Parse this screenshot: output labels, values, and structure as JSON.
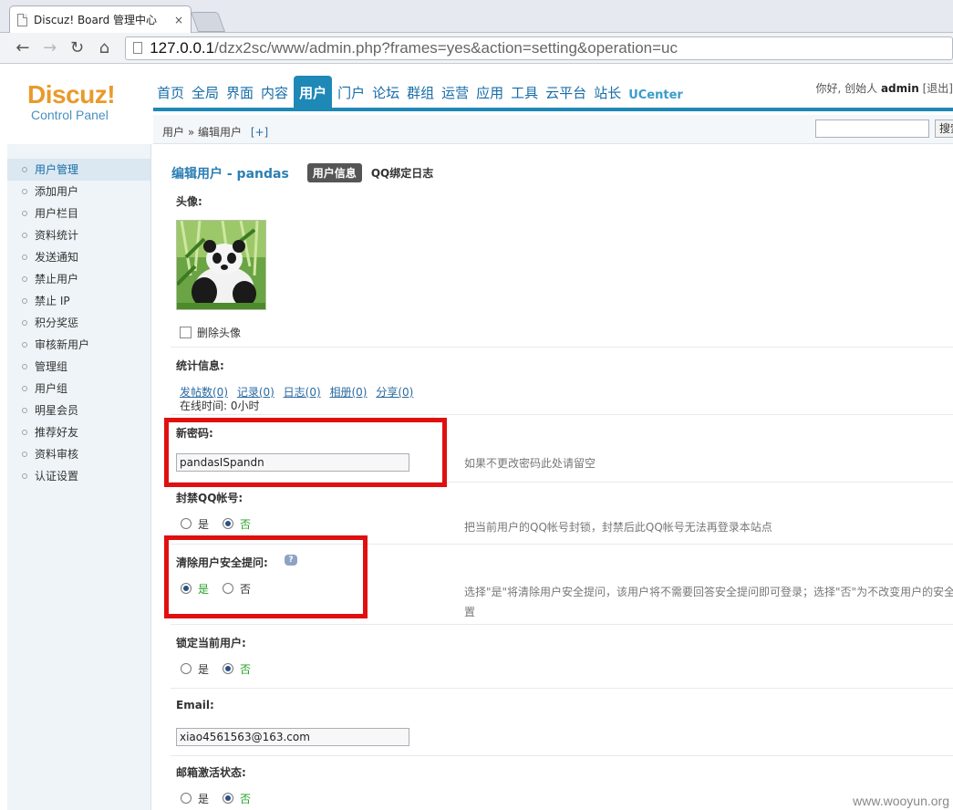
{
  "browser": {
    "tab_title": "Discuz! Board 管理中心",
    "tab_close": "×",
    "url_host": "127.0.0.1",
    "url_path": "/dzx2sc/www/admin.php?frames=yes&action=setting&operation=uc",
    "back": "←",
    "forward": "→",
    "reload": "↻",
    "home": "⌂"
  },
  "header": {
    "logo_main": "Discuz!",
    "logo_sub": "Control Panel",
    "nav": [
      "首页",
      "全局",
      "界面",
      "内容",
      "用户",
      "门户",
      "论坛",
      "群组",
      "运营",
      "应用",
      "工具",
      "云平台",
      "站长",
      "UCenter"
    ],
    "active_nav": "用户",
    "greeting": "你好, 创始人",
    "username": "admin",
    "logout": "[退出]",
    "breadcrumb": "用户 » 编辑用户",
    "breadcrumb_add": "[+]",
    "search_button": "搜索"
  },
  "sidebar": {
    "items": [
      "用户管理",
      "添加用户",
      "用户栏目",
      "资料统计",
      "发送通知",
      "禁止用户",
      "禁止 IP",
      "积分奖惩",
      "审核新用户",
      "管理组",
      "用户组",
      "明星会员",
      "推荐好友",
      "资料审核",
      "认证设置"
    ]
  },
  "main": {
    "title": "编辑用户 - pandas",
    "tab_active": "用户信息",
    "tab_other": "QQ绑定日志",
    "avatar_label": "头像:",
    "delete_avatar": "删除头像",
    "stats_label": "统计信息:",
    "stats": [
      "发帖数(0)",
      "记录(0)",
      "日志(0)",
      "相册(0)",
      "分享(0)"
    ],
    "online_time": "在线时间: 0小时",
    "new_password_label": "新密码:",
    "new_password_value": "pandasISpandn",
    "new_password_hint": "如果不更改密码此处请留空",
    "ban_qq_label": "封禁QQ帐号:",
    "ban_qq_hint": "把当前用户的QQ帐号封锁，封禁后此QQ帐号无法再登录本站点",
    "clear_security_label": "清除用户安全提问:",
    "clear_security_hint_line1": "选择\"是\"将清除用户安全提问，该用户将不需要回答安全提问即可登录；选择\"否\"为不改变用户的安全",
    "clear_security_hint_line2": "置",
    "lock_user_label": "锁定当前用户:",
    "email_label": "Email:",
    "email_value": "xiao4561563@163.com",
    "email_status_label": "邮箱激活状态:",
    "yes": "是",
    "no": "否",
    "help": "?"
  },
  "watermark": "www.wooyun.org",
  "colors": {
    "accent": "#1e88b7",
    "logo": "#e89a2b",
    "highlight_box": "#e01010",
    "link": "#2b6aa0"
  }
}
